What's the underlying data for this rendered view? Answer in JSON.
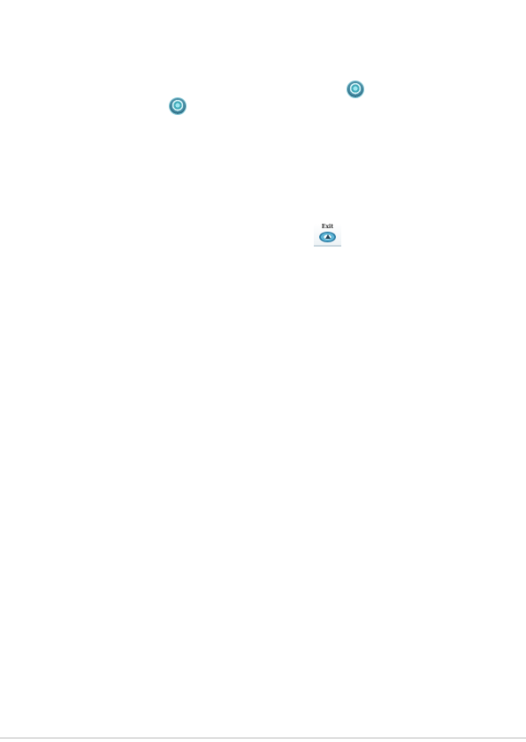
{
  "document": {
    "icons": [
      {
        "name": "round-button-icon"
      },
      {
        "name": "round-button-icon"
      }
    ],
    "exit_button": {
      "label": "Exit",
      "icon": "up-arrow-icon"
    }
  }
}
